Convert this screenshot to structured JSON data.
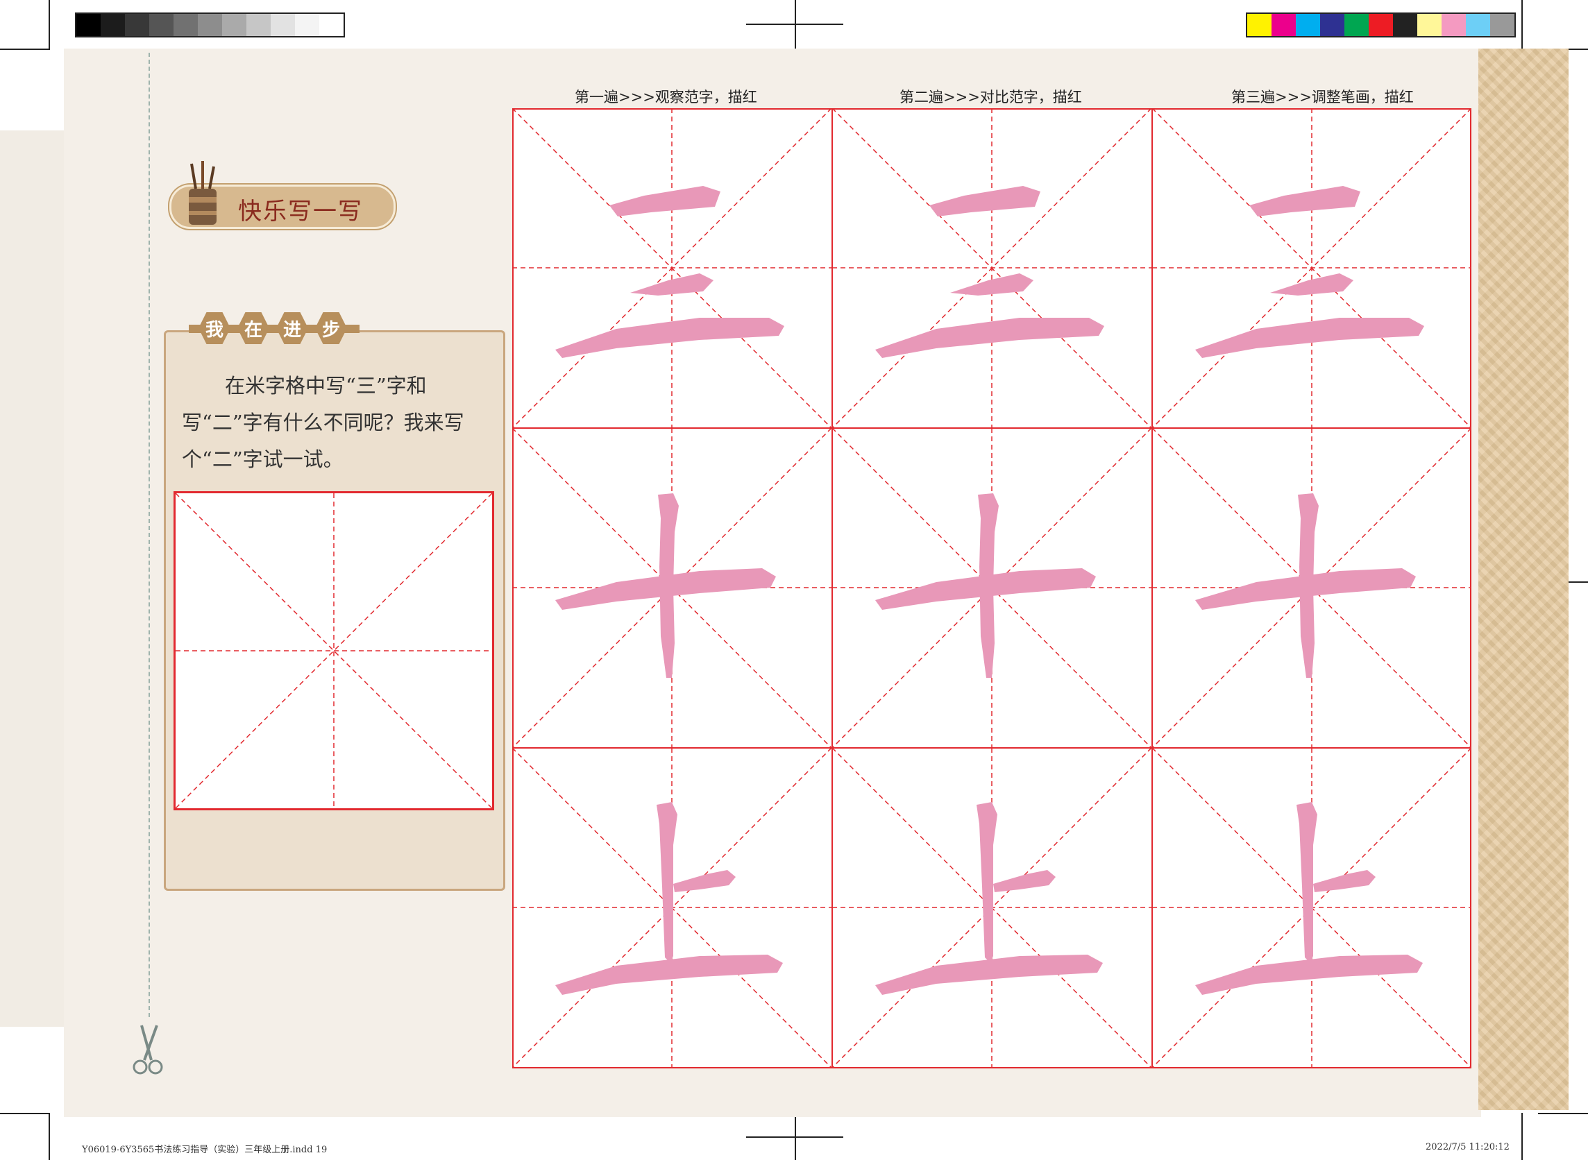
{
  "headings": [
    "第一遍>>>观察范字，描红",
    "第二遍>>>对比范字，描红",
    "第三遍>>>调整笔画，描红"
  ],
  "section_title": "快乐写一写",
  "progress_badge": [
    "我",
    "在",
    "进",
    "步"
  ],
  "question": "在米字格中写“三”字和写“二”字有什么不同呢？我来写个“二”字试一试。",
  "characters": [
    "三",
    "十",
    "上"
  ],
  "footer": {
    "file": "Y06019-6Y3565书法练习指导（实验）三年级上册.indd   19",
    "timestamp": "2022/7/5   11:20:12"
  },
  "colors": {
    "grid_red": "#e2292f",
    "trace_pink": "#e898b8",
    "badge_tan": "#d7b98f",
    "panel_bg": "#ece0cf"
  },
  "icons": [
    "scissors-icon",
    "brush-cup-icon"
  ]
}
